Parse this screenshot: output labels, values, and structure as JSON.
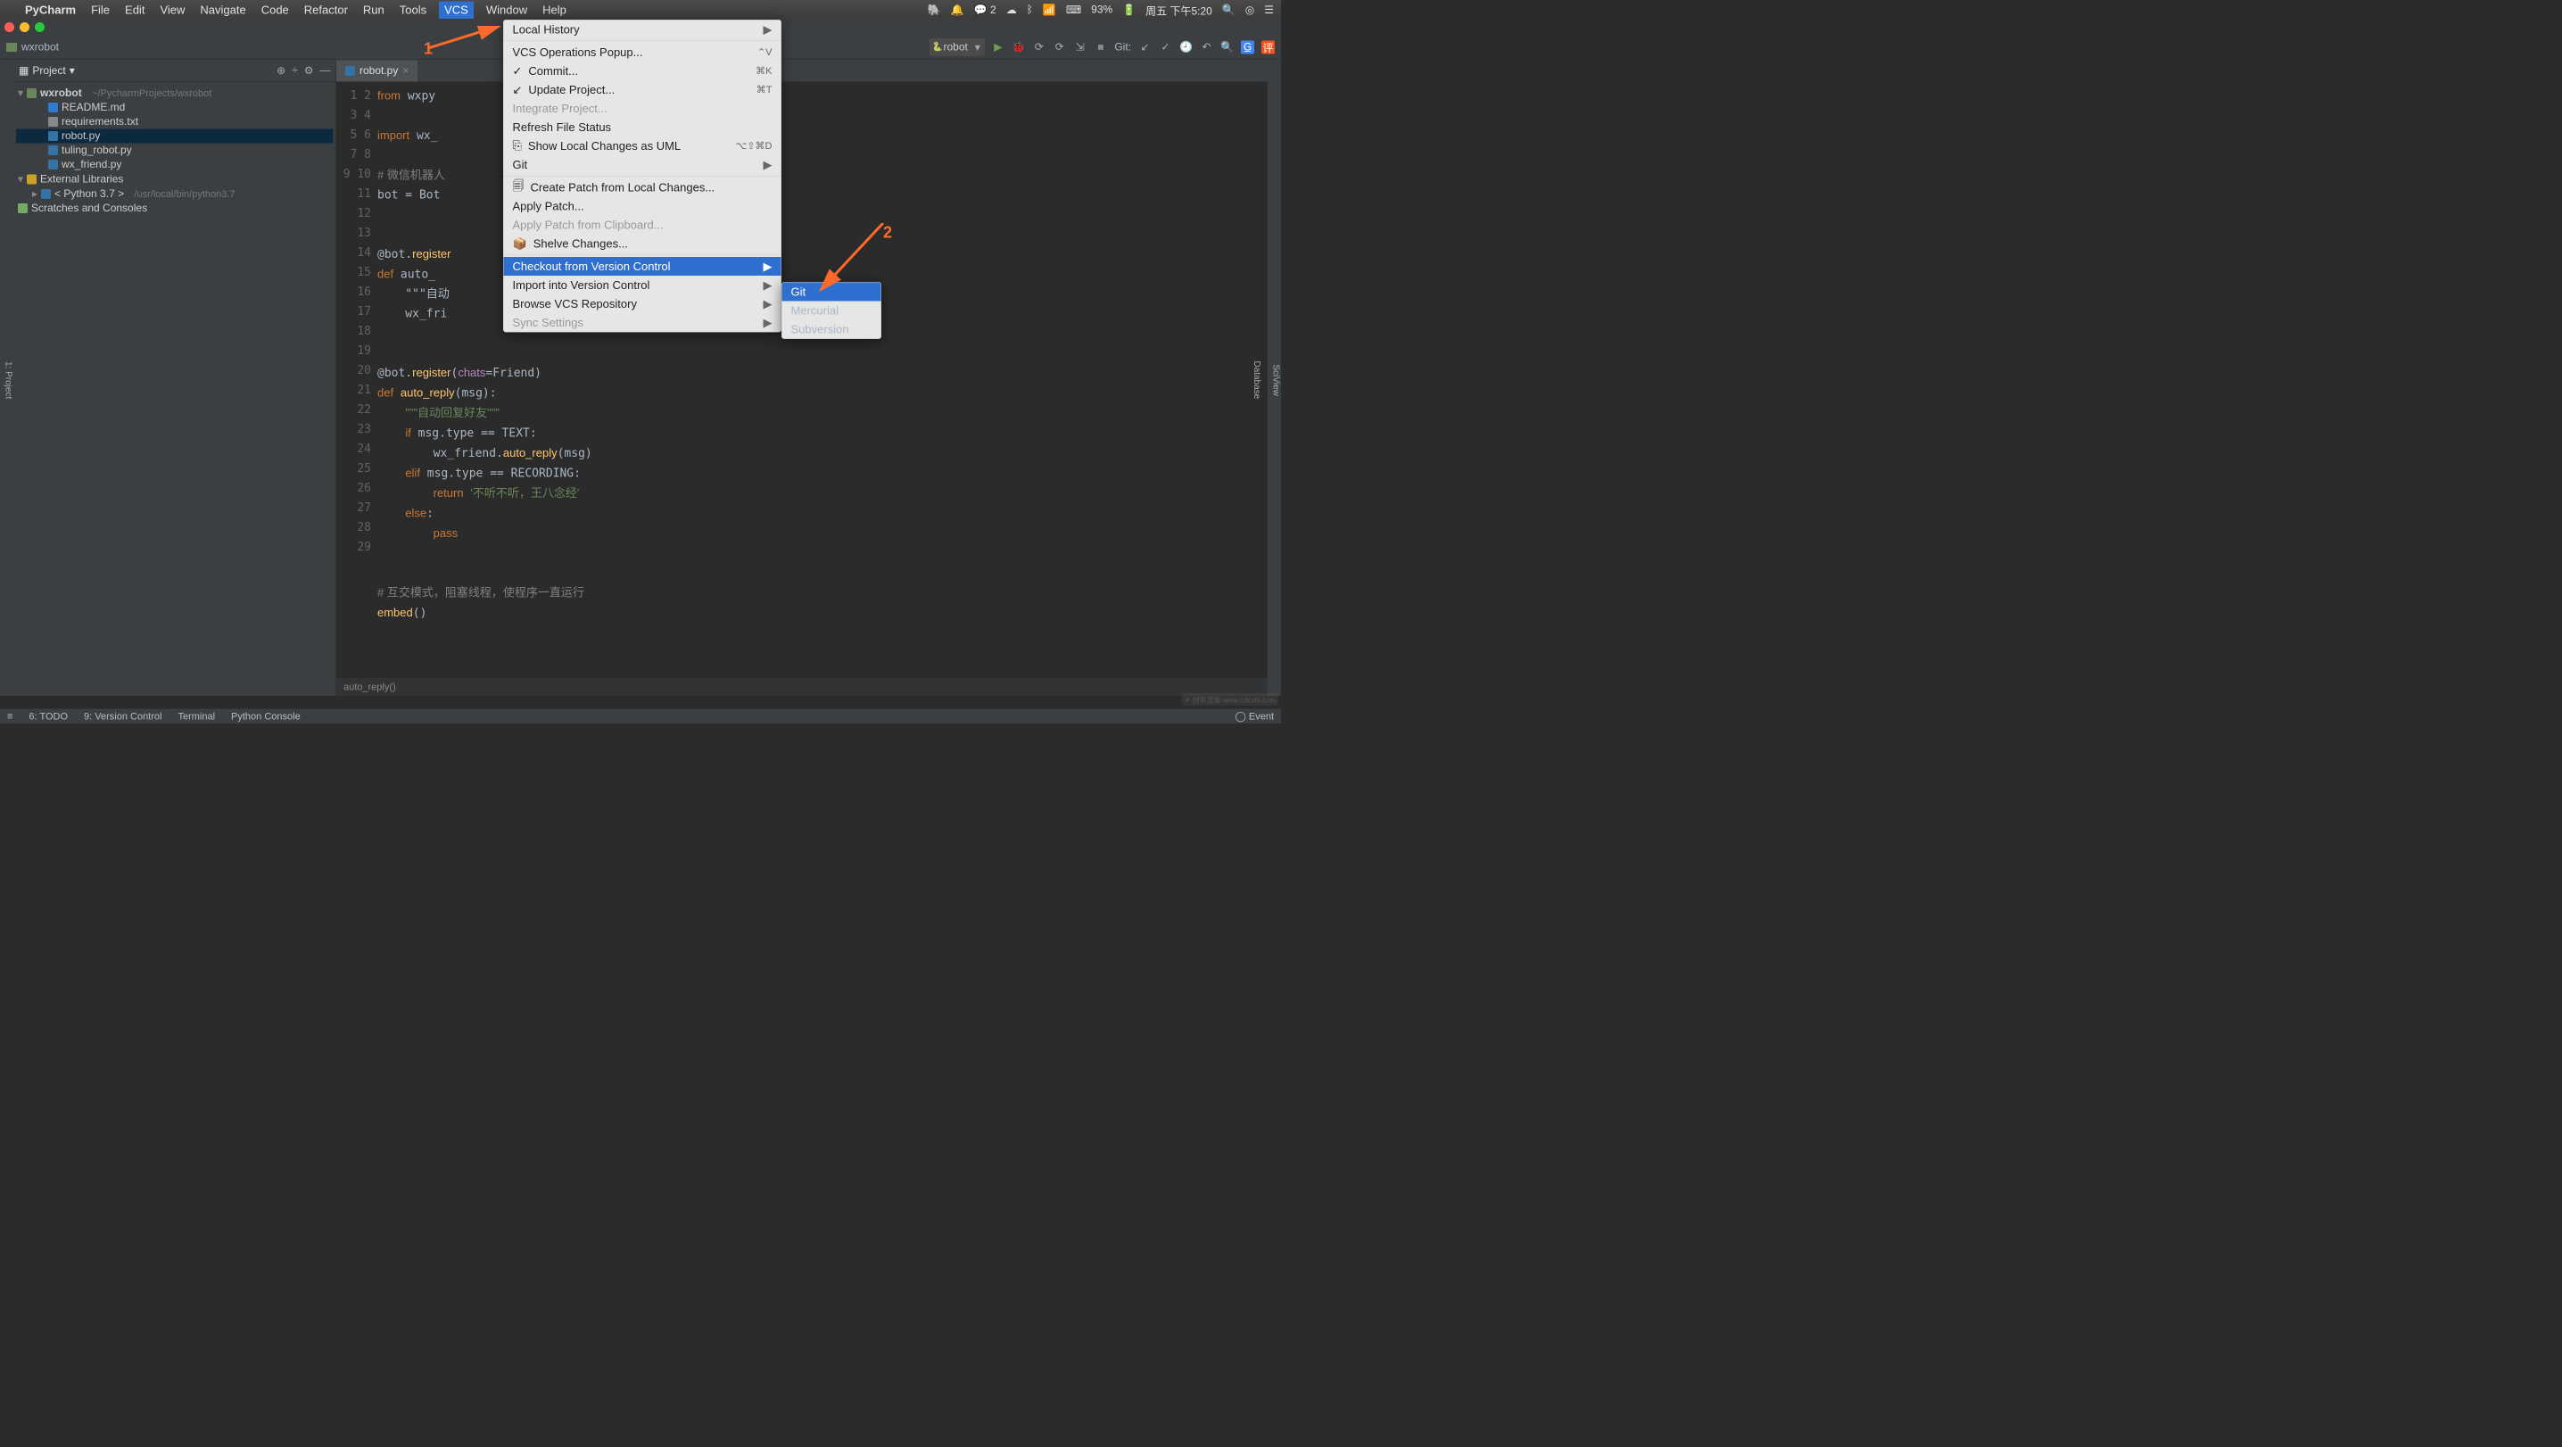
{
  "mac_menu": {
    "app": "PyCharm",
    "items": [
      "File",
      "Edit",
      "View",
      "Navigate",
      "Code",
      "Refactor",
      "Run",
      "Tools",
      "VCS",
      "Window",
      "Help"
    ],
    "status": {
      "battery": "93%",
      "clock": "周五 下午5:20",
      "wechat_badge": "2"
    }
  },
  "window_title": "wxrobot]",
  "breadcrumb": {
    "root": "wxrobot"
  },
  "run_config": "robot",
  "git_label": "Git:",
  "sidebar": {
    "title": "Project",
    "tree": {
      "root": {
        "name": "wxrobot",
        "hint": "~/PycharmProjects/wxrobot"
      },
      "files": [
        "README.md",
        "requirements.txt",
        "robot.py",
        "tuling_robot.py",
        "wx_friend.py"
      ],
      "libs": "External Libraries",
      "python": "< Python 3.7 >",
      "python_hint": "/usr/local/bin/python3.7",
      "scratch": "Scratches and Consoles"
    }
  },
  "tab": {
    "name": "robot.py"
  },
  "code": {
    "lines": [
      "from wxpy",
      "",
      "import wx_",
      "",
      "# 微信机器人",
      "bot = Bot",
      "",
      "",
      "@bot.register",
      "def auto_",
      "    \"\"\"自动",
      "    wx_fri",
      "",
      "",
      "@bot.register(chats=Friend)",
      "def auto_reply(msg):",
      "    \"\"\"自动回复好友\"\"\"",
      "    if msg.type == TEXT:",
      "        wx_friend.auto_reply(msg)",
      "    elif msg.type == RECORDING:",
      "        return '不听不听，王八念经'",
      "    else:",
      "        pass",
      "",
      "",
      "# 互交模式，阻塞线程，使程序一直运行",
      "embed()",
      "",
      ""
    ]
  },
  "crumb_fn": "auto_reply()",
  "vcs_menu": [
    {
      "label": "Local History",
      "sub": true
    },
    {
      "sep": true
    },
    {
      "label": "VCS Operations Popup...",
      "sc": "⌃V"
    },
    {
      "label": "Commit...",
      "sc": "⌘K",
      "icon": "✓"
    },
    {
      "label": "Update Project...",
      "sc": "⌘T",
      "icon": "↙"
    },
    {
      "label": "Integrate Project...",
      "dis": true
    },
    {
      "label": "Refresh File Status"
    },
    {
      "label": "Show Local Changes as UML",
      "sc": "⌥⇧⌘D",
      "icon": "⎘"
    },
    {
      "label": "Git",
      "sub": true
    },
    {
      "sep": true
    },
    {
      "label": "Create Patch from Local Changes...",
      "icon": "🗐"
    },
    {
      "label": "Apply Patch..."
    },
    {
      "label": "Apply Patch from Clipboard...",
      "dis": true
    },
    {
      "label": "Shelve Changes...",
      "icon": "📦"
    },
    {
      "sep": true
    },
    {
      "label": "Checkout from Version Control",
      "sub": true,
      "hl": true
    },
    {
      "label": "Import into Version Control",
      "sub": true
    },
    {
      "label": "Browse VCS Repository",
      "sub": true
    },
    {
      "label": "Sync Settings",
      "sub": true,
      "dis": true
    }
  ],
  "vcs_submenu": [
    "Git",
    "Mercurial",
    "Subversion"
  ],
  "annotations": {
    "one": "1",
    "two": "2"
  },
  "bottom": {
    "left": [
      "≡",
      "6: TODO",
      "9: Version Control",
      "Terminal",
      "Python Console"
    ],
    "right": [
      "Event"
    ]
  }
}
